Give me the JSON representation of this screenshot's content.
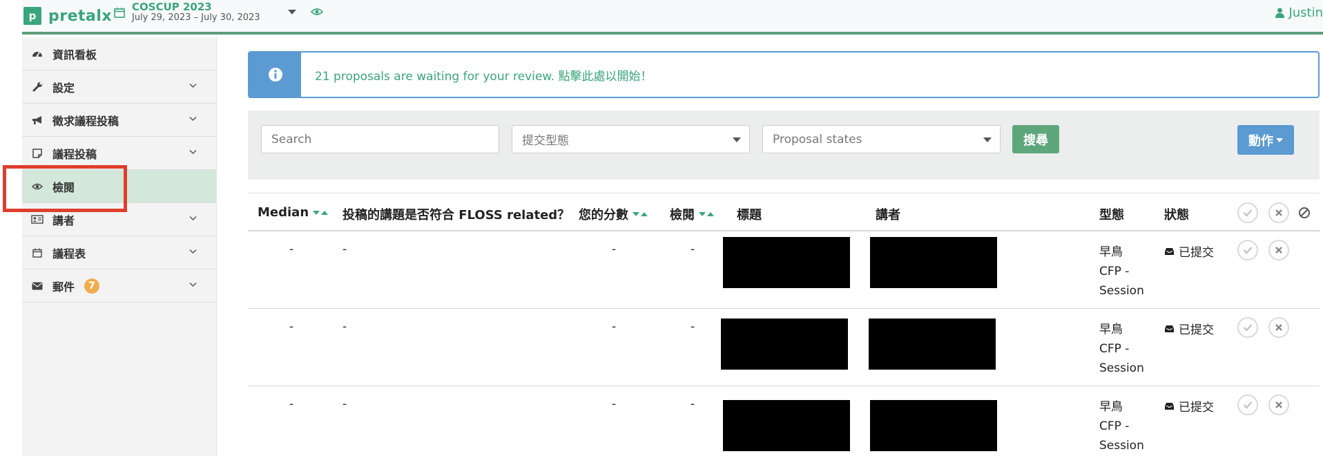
{
  "topnav": {
    "logo_text": "pretalx",
    "logo_letter": "p",
    "event_name": "COSCUP 2023",
    "event_dates": "July 29, 2023 – July 30, 2023",
    "user_name": "Justin"
  },
  "sidebar": {
    "items": [
      {
        "label": "資訊看板",
        "icon": "dashboard-icon"
      },
      {
        "label": "設定",
        "icon": "wrench-icon"
      },
      {
        "label": "徵求議程投稿",
        "icon": "bullhorn-icon"
      },
      {
        "label": "議程投稿",
        "icon": "sticky-note-icon"
      },
      {
        "label": "檢閱",
        "icon": "eye-icon"
      },
      {
        "label": "講者",
        "icon": "id-card-icon"
      },
      {
        "label": "議程表",
        "icon": "calendar-icon"
      },
      {
        "label": "郵件",
        "icon": "envelope-icon",
        "badge": "7"
      }
    ]
  },
  "alert": {
    "text": "21 proposals are waiting for your review. 點擊此處以開始！"
  },
  "filters": {
    "search_placeholder": "Search",
    "type_select": "提交型態",
    "state_select": "Proposal states",
    "search_button": "搜尋",
    "action_button": "動作"
  },
  "table": {
    "headers": {
      "median": "Median",
      "floss": "投稿的講題是否符合 FLOSS related？",
      "your_score": "您的分數",
      "reviews": "檢閱",
      "title": "標題",
      "speakers": "講者",
      "type": "型態",
      "state": "狀態"
    },
    "rows": [
      {
        "median": "-",
        "floss": "-",
        "score": "-",
        "reviews": "-",
        "type_line1": "早鳥",
        "type_line2": "CFP -",
        "type_line3": "Session",
        "state": "已提交"
      },
      {
        "median": "-",
        "floss": "-",
        "score": "-",
        "reviews": "-",
        "type_line1": "早鳥",
        "type_line2": "CFP -",
        "type_line3": "Session",
        "state": "已提交"
      },
      {
        "median": "-",
        "floss": "-",
        "score": "-",
        "reviews": "-",
        "type_line1": "早鳥",
        "type_line2": "CFP -",
        "type_line3": "Session",
        "state": "已提交"
      }
    ]
  },
  "colors": {
    "brand_green": "#3aa57c",
    "info_blue": "#5b9bd1",
    "highlight_red": "#e03e2d",
    "badge_orange": "#f0ad4e"
  }
}
